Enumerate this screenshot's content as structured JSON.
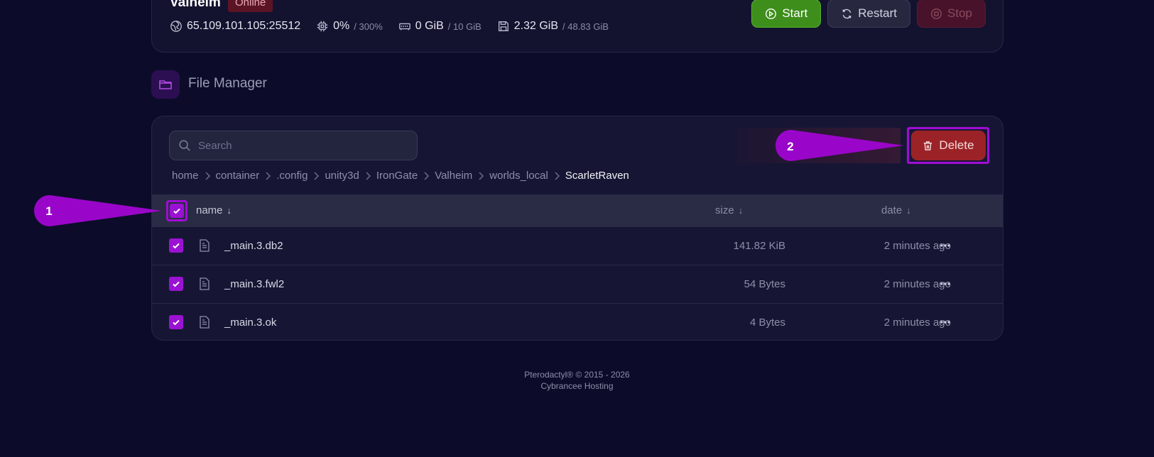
{
  "server": {
    "name": "Valheim",
    "status": "Online",
    "address": "65.109.101.105:25512",
    "cpu": "0%",
    "cpu_limit": "/ 300%",
    "memory": "0 GiB",
    "memory_limit": "/ 10 GiB",
    "disk": "2.32 GiB",
    "disk_limit": "/ 48.83 GiB",
    "buttons": {
      "start": "Start",
      "restart": "Restart",
      "stop": "Stop"
    }
  },
  "file_manager": {
    "title": "File Manager",
    "search_placeholder": "Search",
    "delete_label": "Delete",
    "breadcrumb": [
      "home",
      "container",
      ".config",
      "unity3d",
      "IronGate",
      "Valheim",
      "worlds_local",
      "ScarletRaven"
    ],
    "columns": {
      "name": "name",
      "size": "size",
      "date": "date",
      "sort_arrow": "↓"
    },
    "files": [
      {
        "name": "_main.3.db2",
        "size": "141.82 KiB",
        "date": "2 minutes ago",
        "checked": true
      },
      {
        "name": "_main.3.fwl2",
        "size": "54 Bytes",
        "date": "2 minutes ago",
        "checked": true
      },
      {
        "name": "_main.3.ok",
        "size": "4 Bytes",
        "date": "2 minutes ago",
        "checked": true
      }
    ]
  },
  "annotations": {
    "callout_1": "1",
    "callout_2": "2"
  },
  "footer": {
    "line1": "Pterodactyl® © 2015 - 2026",
    "line2": "Cybrancee Hosting"
  },
  "colors": {
    "accent": "#9a12d2",
    "delete": "#9b2327",
    "start": "#3e8e1c",
    "background": "#0c0c2a"
  }
}
